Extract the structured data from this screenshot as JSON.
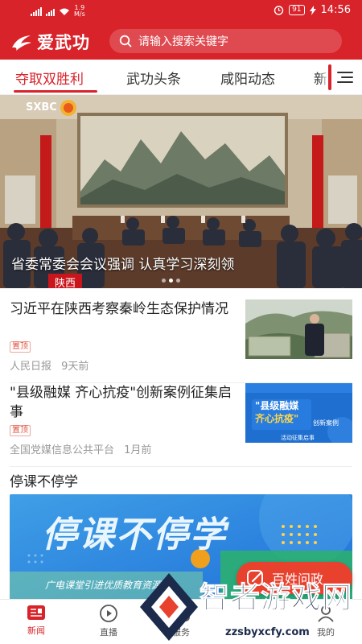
{
  "status_bar": {
    "net_speed_value": "1.9",
    "net_speed_unit": "M/s",
    "battery": "91",
    "time": "14:56"
  },
  "header": {
    "logo_text": "爱武功",
    "search_placeholder": "请输入搜索关键字"
  },
  "tabs": [
    {
      "label": "夺取双胜利",
      "active": true
    },
    {
      "label": "武功头条",
      "active": false
    },
    {
      "label": "咸阳动态",
      "active": false
    },
    {
      "label": "新",
      "active": false
    }
  ],
  "hero": {
    "tv_logo": "SXBC",
    "caption": "省委常委会会议强调 认真学习深刻领",
    "region_tag": "陕西",
    "dots": 3,
    "active_dot": 1
  },
  "news": [
    {
      "title": "习近平在陕西考察秦岭生态保护情况",
      "tag": "置顶",
      "source": "人民日报",
      "time": "9天前"
    },
    {
      "title": "\"县级融媒 齐心抗疫\"创新案例征集启事",
      "tag": "置顶",
      "source": "全国党媒信息公共平台",
      "time": "1月前",
      "thumb_line1": "\"县级融媒",
      "thumb_line2": "齐心抗疫\"",
      "thumb_suffix": "创新案例",
      "thumb_footer": "活动征集启事"
    }
  ],
  "section": {
    "title": "停课不停学",
    "banner_title": "停课不停学",
    "banner_subtitle": "广电课堂引进优质教育资源"
  },
  "float_button": {
    "label": "百姓问政"
  },
  "bottom_nav": [
    {
      "label": "新闻",
      "icon": "news-icon",
      "active": true
    },
    {
      "label": "直播",
      "icon": "play-icon",
      "active": false
    },
    {
      "label": "服务",
      "icon": "service-icon",
      "active": false
    },
    {
      "label": "我的",
      "icon": "profile-icon",
      "active": false
    }
  ],
  "watermark": {
    "text": "智者游戏网",
    "url": "zzsbyxcfy.com"
  },
  "colors": {
    "brand_red": "#d8232a",
    "tag_red": "#e0523f",
    "float_red": "#e8412e"
  }
}
